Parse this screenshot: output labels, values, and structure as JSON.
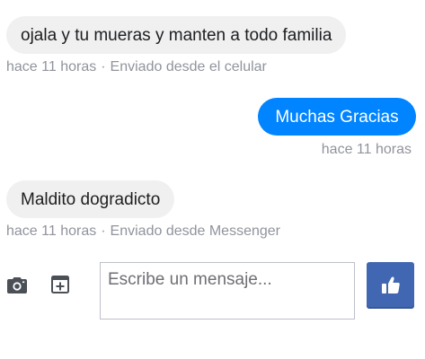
{
  "messages": [
    {
      "direction": "incoming",
      "text": "ojala y tu mueras y manten a todo familia",
      "time": "hace 11 horas",
      "separator": "·",
      "source": "Enviado desde el celular"
    },
    {
      "direction": "outgoing",
      "text": "Muchas Gracias",
      "time": "hace 11 horas"
    },
    {
      "direction": "incoming",
      "text": "Maldito dogradicto",
      "time": "hace 11 horas",
      "separator": "·",
      "source": "Enviado desde Messenger"
    }
  ],
  "composer": {
    "placeholder": "Escribe un mensaje...",
    "value": "",
    "icons": {
      "camera": "camera-icon",
      "sticker": "add-attachment-icon",
      "like": "thumbs-up-icon"
    }
  },
  "colors": {
    "outgoing_bubble": "#0084ff",
    "incoming_bubble": "#f1f0f0",
    "like_button": "#4267b2",
    "meta_text": "#90949c",
    "icon": "#4b4f56"
  }
}
